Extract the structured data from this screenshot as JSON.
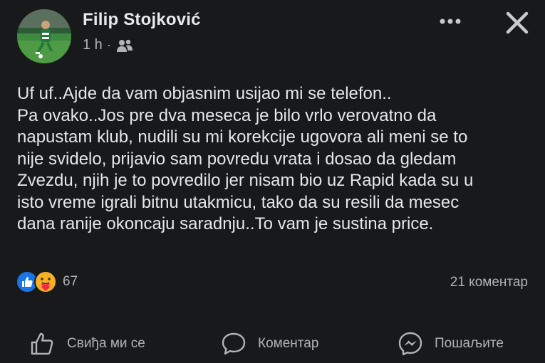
{
  "post": {
    "author_name": "Filip Stojković",
    "time": "1 h",
    "separator": "·",
    "audience_icon": "friends-icon",
    "text": "Uf uf..Ajde da vam objasnim usijao mi se telefon..\nPa ovako..Jos pre dva meseca je bilo vrlo verovatno da\nnapustam klub, nudili su mi korekcije ugovora ali meni se to\nnije svidelo, prijavio sam povredu vrata i dosao da gledam\nZvezdu, njih je to povredilo jer nisam bio uz Rapid kada su u\nisto vreme igrali bitnu utakmicu, tako da su resili da mesec\ndana ranije okoncaju saradnju..To vam je sustina price."
  },
  "reactions": {
    "types": [
      "like",
      "care"
    ],
    "count": "67"
  },
  "comments": {
    "count_label": "21 коментар"
  },
  "actions": {
    "like_label": "Свиђа ми се",
    "comment_label": "Коментар",
    "share_label": "Пошаљите"
  },
  "colors": {
    "background": "#18191b",
    "text": "#e4e6eb",
    "secondary_text": "#b0b3b8",
    "like_blue": "#1b74e4",
    "care_yellow": "#f7b125"
  }
}
